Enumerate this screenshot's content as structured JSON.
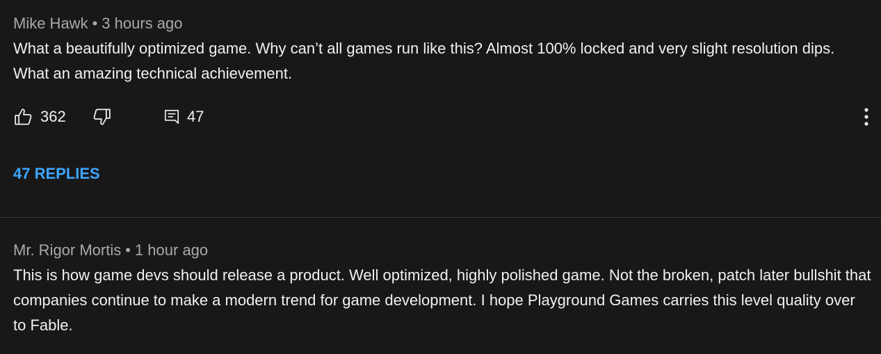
{
  "comments": [
    {
      "author": "Mike Hawk",
      "separator": "•",
      "time": "3 hours ago",
      "text": "What a beautifully optimized game. Why can’t all games run like this? Almost 100% locked and very slight resolution dips. What an amazing technical achievement.",
      "likes": "362",
      "reply_count": "47",
      "replies_link": "47 REPLIES"
    },
    {
      "author": "Mr. Rigor Mortis",
      "separator": "•",
      "time": "1 hour ago",
      "text": "This is how game devs should release a product. Well optimized, highly polished game. Not the broken, patch later bullshit that companies continue to make a modern trend for game development. I hope Playground Games carries this level quality over to Fable."
    }
  ],
  "icons": {
    "like": "thumbs-up-icon",
    "dislike": "thumbs-down-icon",
    "reply": "comment-icon",
    "more": "more-vert-icon"
  },
  "colors": {
    "background": "#181818",
    "text": "#f1f1f1",
    "meta": "#aaaaaa",
    "link": "#3ea6ff",
    "divider": "#3a3a3a"
  }
}
